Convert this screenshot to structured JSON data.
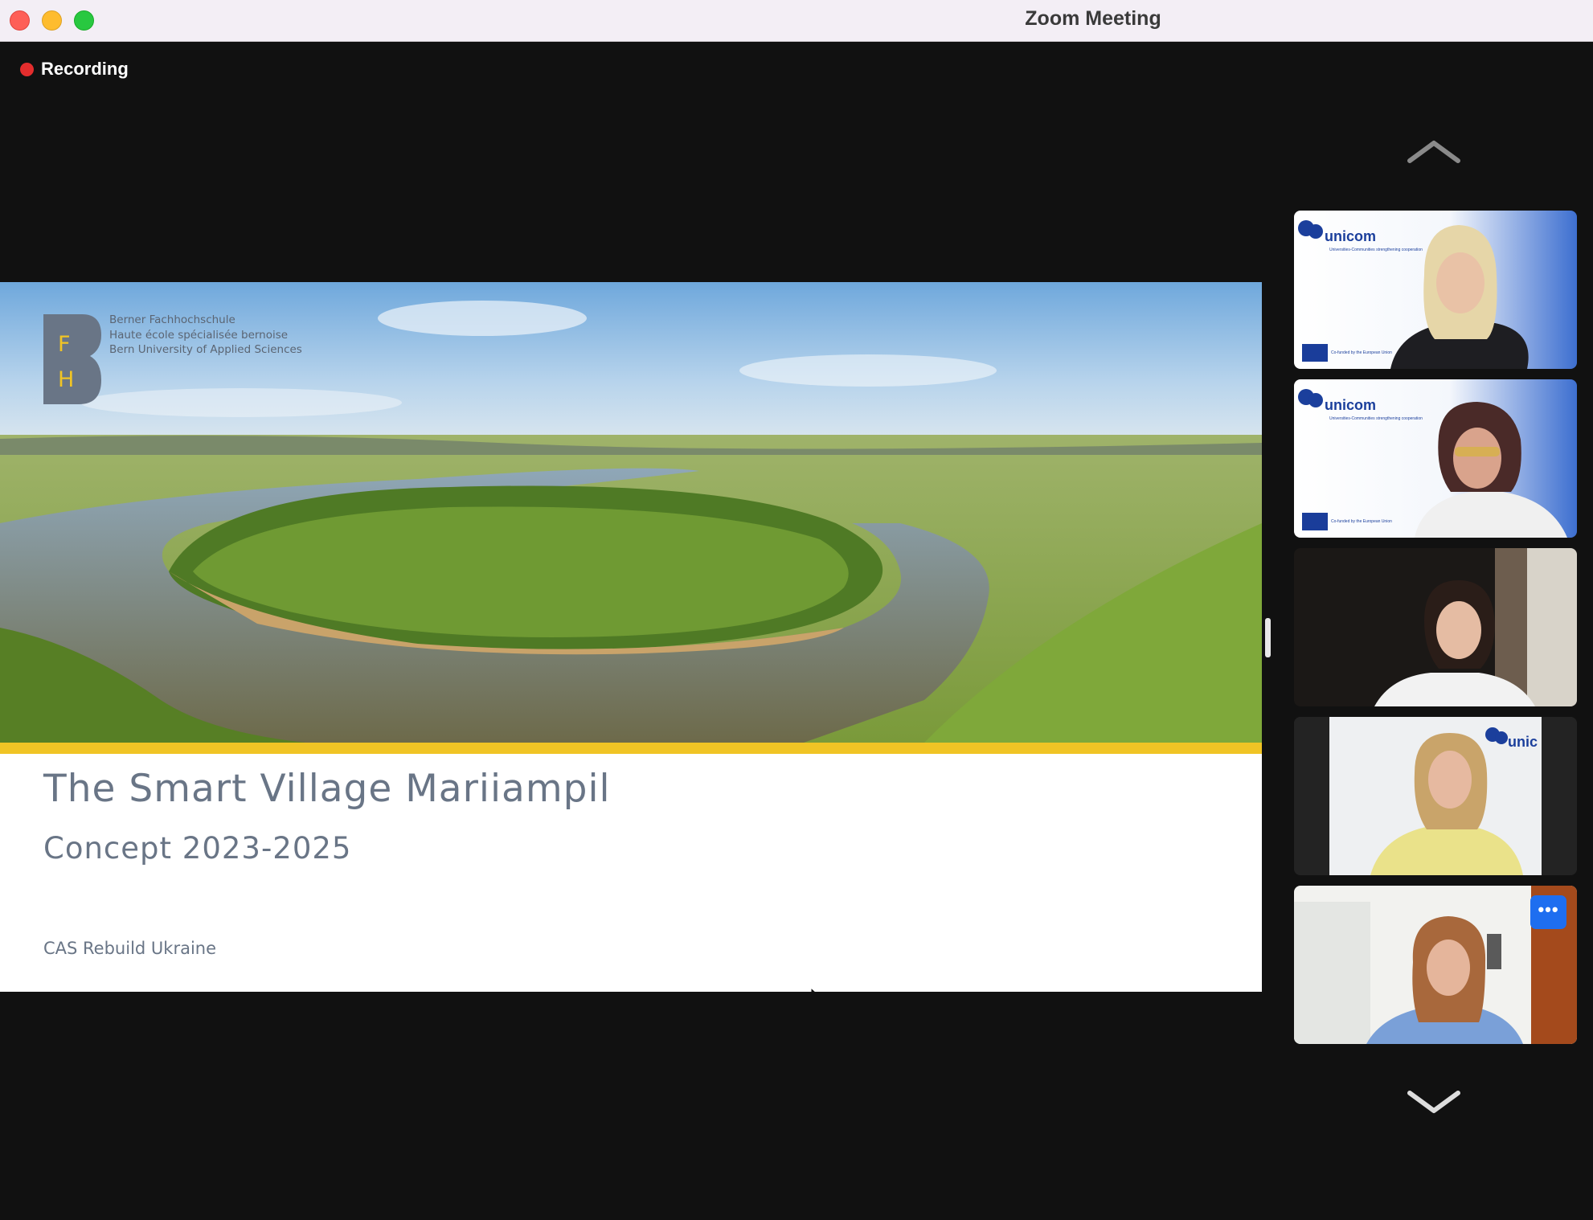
{
  "window": {
    "title": "Zoom Meeting"
  },
  "recording": {
    "label": "Recording",
    "color": "#e42d2d"
  },
  "slide": {
    "institution_lines": [
      "Berner Fachhochschule",
      "Haute école spécialisée bernoise",
      "Bern University of Applied Sciences"
    ],
    "logo_letters": [
      "F",
      "H"
    ],
    "title": "The Smart Village Mariiampil",
    "subtitle": "Concept 2023-2025",
    "footer": "CAS Rebuild Ukraine",
    "accent_color": "#f0c425"
  },
  "gallery": {
    "scroll_up_icon": "chevron-up-icon",
    "scroll_down_icon": "chevron-down-icon",
    "participants": [
      {
        "background_logo": "unicom",
        "background_tagline": "Universities-Communities strengthening cooperation",
        "eu_caption": "Co-funded by the European Union"
      },
      {
        "background_logo": "unicom",
        "background_tagline": "Universities-Communities strengthening cooperation",
        "eu_caption": "Co-funded by the European Union"
      },
      {
        "background_logo": "",
        "background_tagline": "",
        "eu_caption": ""
      },
      {
        "background_logo": "uniс",
        "background_tagline": "",
        "eu_caption": ""
      },
      {
        "background_logo": "",
        "background_tagline": "",
        "eu_caption": "",
        "more_button_label": "•••"
      }
    ]
  }
}
